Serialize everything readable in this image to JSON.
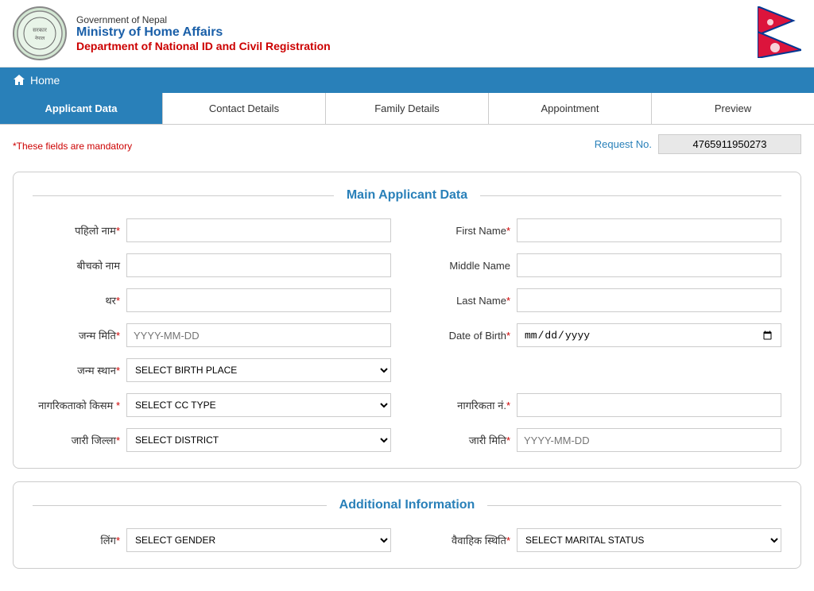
{
  "header": {
    "gov_line": "Government of Nepal",
    "ministry": "Ministry of Home Affairs",
    "department": "Department of National ID and Civil Registration"
  },
  "navbar": {
    "home_label": "Home"
  },
  "tabs": [
    {
      "id": "applicant-data",
      "label": "Applicant Data",
      "active": true
    },
    {
      "id": "contact-details",
      "label": "Contact Details",
      "active": false
    },
    {
      "id": "family-details",
      "label": "Family Details",
      "active": false
    },
    {
      "id": "appointment",
      "label": "Appointment",
      "active": false
    },
    {
      "id": "preview",
      "label": "Preview",
      "active": false
    }
  ],
  "mandatory_note": "*These fields are mandatory",
  "request_no_label": "Request No.",
  "request_no_value": "4765911950273",
  "main_section": {
    "title": "Main Applicant Data",
    "fields": {
      "pahilo_naam_label": "पहिलो नाम",
      "bichko_naam_label": "बीचको नाम",
      "thar_label": "थर",
      "janma_miti_label": "जन्म मिति",
      "janma_sthan_label": "जन्म स्थान",
      "nagarikta_kisam_label": "नागरिकताको किसम",
      "jaari_jilla_label": "जारी जिल्ला",
      "first_name_label": "First Name",
      "middle_name_label": "Middle Name",
      "last_name_label": "Last Name",
      "dob_label": "Date of Birth",
      "nagarikta_no_label": "नागरिकता नं.",
      "jaari_miti_label": "जारी मिति",
      "janma_miti_placeholder": "YYYY-MM-DD",
      "jaari_miti_placeholder": "YYYY-MM-DD",
      "dob_placeholder": "mm/dd/yyyy",
      "birth_place_placeholder": "SELECT BIRTH PLACE",
      "cc_type_placeholder": "SELECT CC TYPE",
      "district_placeholder": "SELECT DISTRICT"
    }
  },
  "additional_section": {
    "title": "Additional Information",
    "fields": {
      "ling_label": "लिंग",
      "vaivahik_label": "वैवाहिक स्थिति",
      "gender_placeholder": "SELECT GENDER",
      "marital_placeholder": "SELECT MARITAL STATUS"
    }
  }
}
